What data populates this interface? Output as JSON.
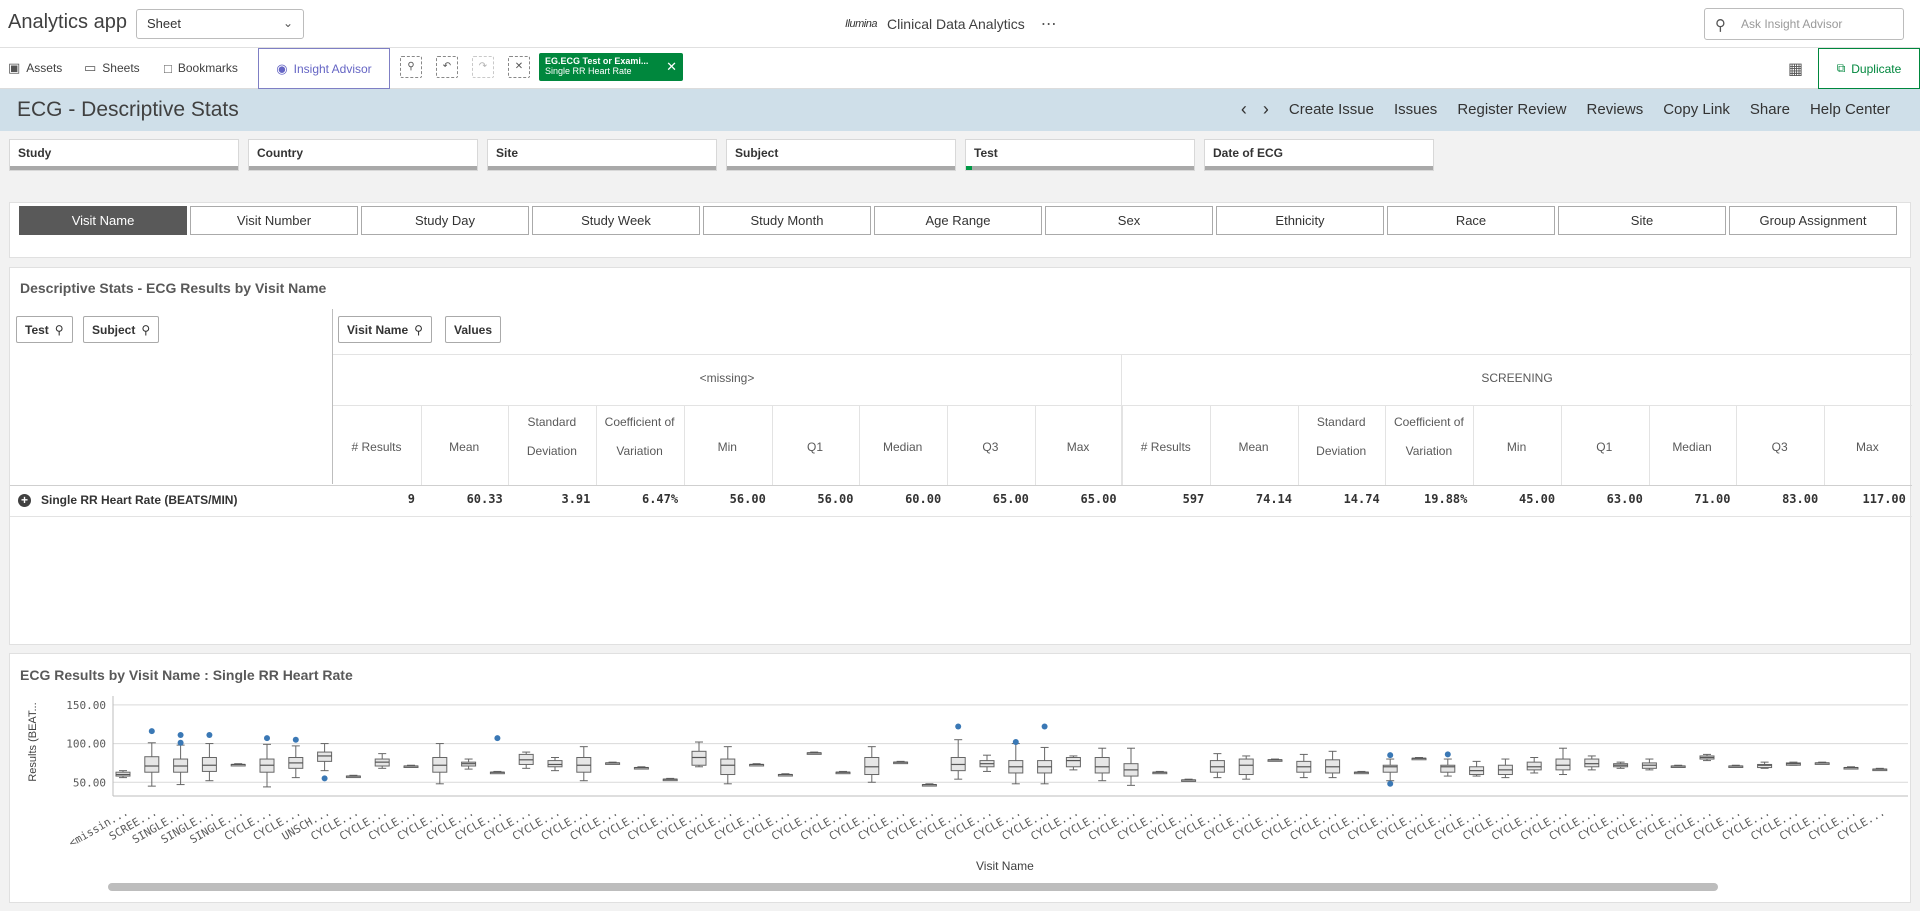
{
  "header": {
    "app_name": "Analytics app",
    "sheet_select": "Sheet",
    "center_logo": "Ilumina",
    "center_title": "Clinical Data Analytics",
    "ask_placeholder": "Ask Insight Advisor"
  },
  "toolbar": {
    "assets": "Assets",
    "sheets": "Sheets",
    "bookmarks": "Bookmarks",
    "insight": "Insight Advisor",
    "selection_field": "EG.ECG Test or Exami...",
    "selection_value": "Single RR Heart Rate",
    "duplicate": "Duplicate"
  },
  "sheet": {
    "title": "ECG - Descriptive Stats",
    "links": [
      "Create Issue",
      "Issues",
      "Register Review",
      "Reviews",
      "Copy Link",
      "Share",
      "Help Center"
    ]
  },
  "filters": [
    "Study",
    "Country",
    "Site",
    "Subject",
    "Test",
    "Date of ECG"
  ],
  "dimensions": [
    "Visit Name",
    "Visit Number",
    "Study Day",
    "Study Week",
    "Study Month",
    "Age Range",
    "Sex",
    "Ethnicity",
    "Race",
    "Site",
    "Group Assignment"
  ],
  "pivot": {
    "title": "Descriptive Stats - ECG Results by Visit Name",
    "row_chips": [
      "Test",
      "Subject"
    ],
    "col_chips": [
      "Visit Name",
      "Values"
    ],
    "groups": [
      "<missing>",
      "SCREENING"
    ],
    "measures": [
      [
        "# Results"
      ],
      [
        "Mean"
      ],
      [
        "Standard",
        "Deviation"
      ],
      [
        "Coefficient of",
        "Variation"
      ],
      [
        "Min"
      ],
      [
        "Q1"
      ],
      [
        "Median"
      ],
      [
        "Q3"
      ],
      [
        "Max"
      ]
    ],
    "row_label": "Single RR Heart Rate (BEATS/MIN)",
    "values": [
      "9",
      "60.33",
      "3.91",
      "6.47%",
      "56.00",
      "56.00",
      "60.00",
      "65.00",
      "65.00",
      "597",
      "74.14",
      "14.74",
      "19.88%",
      "45.00",
      "63.00",
      "71.00",
      "83.00",
      "117.00"
    ]
  },
  "chart": {
    "title": "ECG Results by Visit Name : Single RR Heart Rate",
    "y_title": "Results (BEAT...",
    "x_title": "Visit Name"
  },
  "chart_data": {
    "type": "boxplot",
    "title": "ECG Results by Visit Name : Single RR Heart Rate",
    "xlabel": "Visit Name",
    "ylabel": "Results (BEAT...",
    "ylim": [
      40,
      155
    ],
    "yticks": [
      "50.00",
      "100.00",
      "150.00"
    ],
    "categories": [
      "<missin...",
      "SCREE...",
      "SINGLE...",
      "SINGLE...",
      "SINGLE...",
      "CYCLE...",
      "CYCLE...",
      "UNSCH...",
      "CYCLE...",
      "CYCLE...",
      "CYCLE...",
      "CYCLE...",
      "CYCLE...",
      "CYCLE...",
      "CYCLE...",
      "CYCLE...",
      "CYCLE...",
      "CYCLE...",
      "CYCLE...",
      "CYCLE...",
      "CYCLE...",
      "CYCLE...",
      "CYCLE...",
      "CYCLE...",
      "CYCLE...",
      "CYCLE...",
      "CYCLE...",
      "CYCLE...",
      "CYCLE...",
      "CYCLE...",
      "CYCLE...",
      "CYCLE...",
      "CYCLE...",
      "CYCLE...",
      "CYCLE...",
      "CYCLE...",
      "CYCLE...",
      "CYCLE...",
      "CYCLE...",
      "CYCLE...",
      "CYCLE...",
      "CYCLE...",
      "CYCLE...",
      "CYCLE...",
      "CYCLE...",
      "CYCLE...",
      "CYCLE...",
      "CYCLE...",
      "CYCLE...",
      "CYCLE...",
      "CYCLE...",
      "CYCLE...",
      "CYCLE...",
      "CYCLE...",
      "CYCLE...",
      "CYCLE...",
      "CYCLE...",
      "CYCLE...",
      "CYCLE...",
      "CYCLE...",
      "CYCLE...",
      "CYCLE..."
    ],
    "boxes": [
      [
        56,
        58,
        60,
        63,
        65
      ],
      [
        45,
        63,
        71,
        83,
        101
      ],
      [
        47,
        63,
        71,
        80,
        98
      ],
      [
        52,
        64,
        72,
        82,
        100
      ],
      [
        72,
        72,
        73,
        73,
        74
      ],
      [
        44,
        63,
        72,
        80,
        99
      ],
      [
        56,
        68,
        75,
        82,
        97
      ],
      [
        65,
        77,
        84,
        89,
        100
      ],
      [
        57,
        57,
        58,
        58,
        59
      ],
      [
        68,
        71,
        76,
        80,
        87
      ],
      [
        70,
        70,
        71,
        71,
        72
      ],
      [
        48,
        63,
        72,
        82,
        100
      ],
      [
        67,
        71,
        74,
        76,
        80
      ],
      [
        62,
        62,
        63,
        63,
        64
      ],
      [
        68,
        73,
        79,
        86,
        89
      ],
      [
        65,
        70,
        73,
        78,
        82
      ],
      [
        52,
        63,
        72,
        82,
        96
      ],
      [
        74,
        74,
        75,
        75,
        76
      ],
      [
        68,
        68,
        69,
        69,
        70
      ],
      [
        53,
        53,
        54,
        54,
        55
      ],
      [
        70,
        72,
        82,
        90,
        102
      ],
      [
        48,
        60,
        72,
        80,
        96
      ],
      [
        72,
        72,
        73,
        73,
        74
      ],
      [
        59,
        59,
        60,
        60,
        61
      ],
      [
        87,
        87,
        88,
        88,
        89
      ],
      [
        62,
        62,
        63,
        63,
        64
      ],
      [
        50,
        60,
        70,
        82,
        96
      ],
      [
        75,
        75,
        76,
        76,
        77
      ],
      [
        46,
        46,
        47,
        47,
        48
      ],
      [
        54,
        65,
        73,
        82,
        105
      ],
      [
        64,
        70,
        74,
        78,
        85
      ],
      [
        48,
        62,
        70,
        78,
        100
      ],
      [
        48,
        62,
        70,
        78,
        95
      ],
      [
        66,
        70,
        78,
        82,
        84
      ],
      [
        52,
        62,
        70,
        82,
        94
      ],
      [
        46,
        58,
        66,
        74,
        94
      ],
      [
        62,
        62,
        63,
        63,
        64
      ],
      [
        52,
        52,
        53,
        53,
        54
      ],
      [
        56,
        63,
        70,
        78,
        87
      ],
      [
        54,
        60,
        72,
        80,
        84
      ],
      [
        78,
        78,
        79,
        79,
        80
      ],
      [
        56,
        63,
        70,
        77,
        86
      ],
      [
        56,
        62,
        70,
        79,
        90
      ],
      [
        62,
        62,
        63,
        63,
        64
      ],
      [
        52,
        63,
        70,
        72,
        80
      ],
      [
        80,
        80,
        81,
        81,
        82
      ],
      [
        58,
        63,
        70,
        72,
        80
      ],
      [
        58,
        60,
        65,
        70,
        77
      ],
      [
        56,
        60,
        66,
        72,
        80
      ],
      [
        62,
        66,
        70,
        76,
        82
      ],
      [
        60,
        66,
        72,
        80,
        94
      ],
      [
        66,
        70,
        74,
        80,
        84
      ],
      [
        68,
        70,
        72,
        74,
        76
      ],
      [
        66,
        68,
        72,
        75,
        80
      ],
      [
        70,
        70,
        71,
        71,
        72
      ],
      [
        78,
        80,
        82,
        84,
        86
      ],
      [
        70,
        70,
        71,
        71,
        72
      ],
      [
        68,
        69,
        72,
        73,
        76
      ],
      [
        72,
        72,
        74,
        75,
        76
      ],
      [
        74,
        74,
        75,
        75,
        76
      ],
      [
        68,
        68,
        69,
        69,
        70
      ],
      [
        66,
        66,
        67,
        67,
        68
      ]
    ],
    "outliers": [
      [
        1,
        116
      ],
      [
        2,
        101
      ],
      [
        2,
        111
      ],
      [
        3,
        111
      ],
      [
        5,
        107
      ],
      [
        6,
        105
      ],
      [
        7,
        55
      ],
      [
        13,
        107
      ],
      [
        29,
        122
      ],
      [
        31,
        102
      ],
      [
        32,
        122
      ],
      [
        44,
        85
      ],
      [
        44,
        48
      ],
      [
        46,
        86
      ]
    ]
  }
}
